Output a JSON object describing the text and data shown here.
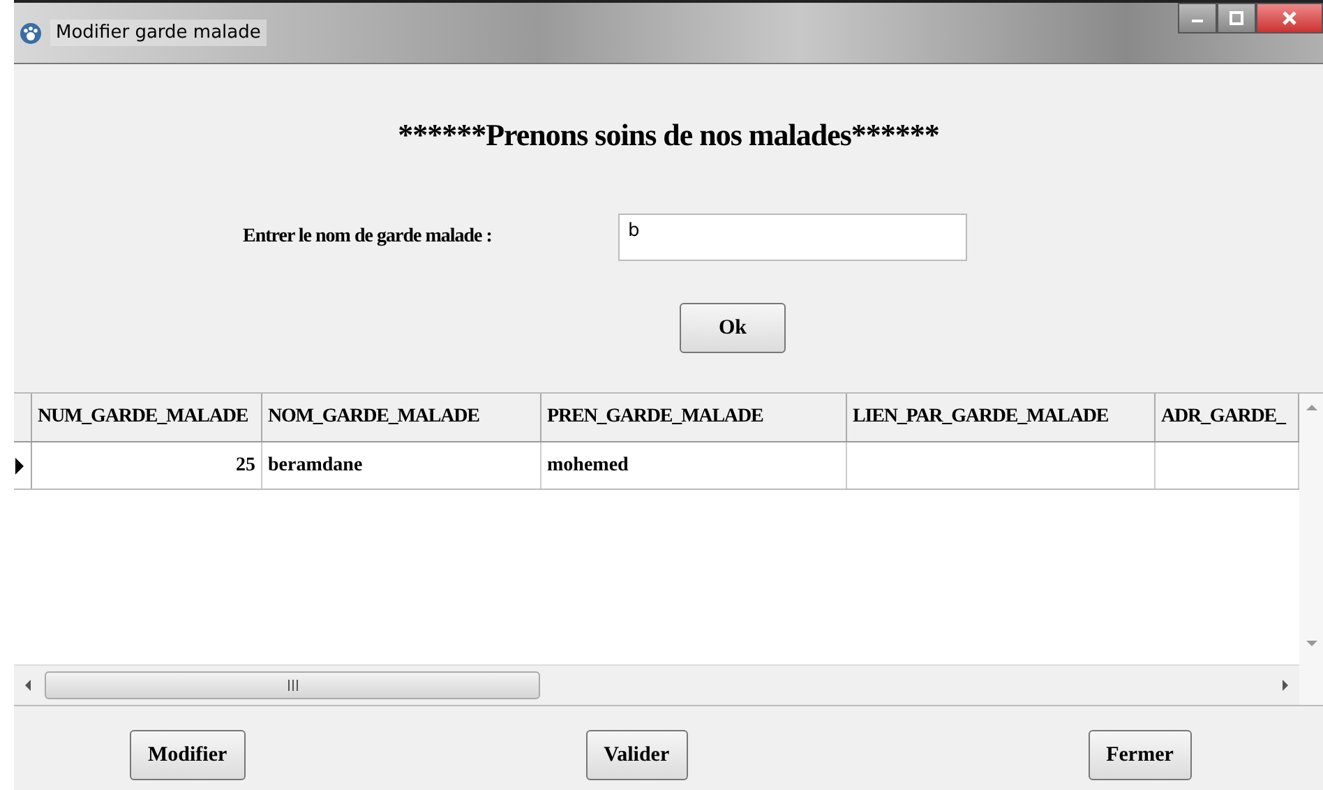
{
  "window": {
    "title": "Modifier garde malade"
  },
  "heading": "******Prenons soins de nos malades******",
  "search": {
    "label": "Entrer le nom de garde malade :",
    "value": "b",
    "button": "Ok"
  },
  "table": {
    "columns": [
      "NUM_GARDE_MALADE",
      "NOM_GARDE_MALADE",
      "PREN_GARDE_MALADE",
      "LIEN_PAR_GARDE_MALADE",
      "ADR_GARDE_"
    ],
    "rows": [
      {
        "selected": true,
        "cells": [
          "25",
          "beramdane",
          "mohemed",
          "",
          ""
        ]
      }
    ]
  },
  "buttons": [
    "Modifier",
    "Valider",
    "Fermer"
  ]
}
